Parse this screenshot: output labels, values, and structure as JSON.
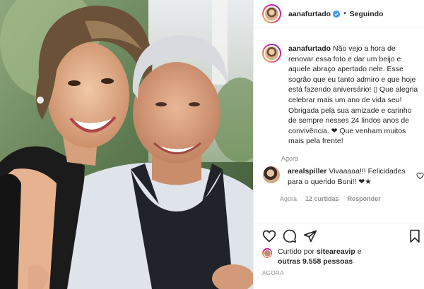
{
  "header": {
    "username": "aanafurtado",
    "separator": "•",
    "follow_status": "Seguindo"
  },
  "caption": {
    "username": "aanafurtado",
    "text": "Não vejo a hora de renovar essa foto e dar um beijo e aquele abraço apertado nele. Esse sogrão que eu tanto admiro e que hoje está fazendo aniversário! ▯ Que alegria celebrar mais um ano de vida seu! Obrigada pela sua amizade e carinho de sempre nesses 24 lindos anos de convivência. ❤ Que venham muitos mais pela frente!",
    "time": "Agora"
  },
  "comment": {
    "username": "arealspiller",
    "text": "Vivaaaaa!!! Felicidades para o querido Boni!! ❤★",
    "time": "Agora",
    "likes": "12 curtidas",
    "reply": "Responder"
  },
  "likes": {
    "prefix": "Curtido por",
    "liked_by": "siteareavip",
    "connector": "e",
    "others": "outras 9.558 pessoas"
  },
  "posted": "AGORA",
  "icons": {
    "verified": "verified-badge-icon",
    "comment_like": "heart-icon",
    "like": "heart-icon",
    "comment": "comment-icon",
    "share": "share-icon",
    "save": "bookmark-icon"
  },
  "colors": {
    "verified": "#3897f0",
    "text": "#262626",
    "muted": "#8e8e8e",
    "border": "#efefef"
  }
}
